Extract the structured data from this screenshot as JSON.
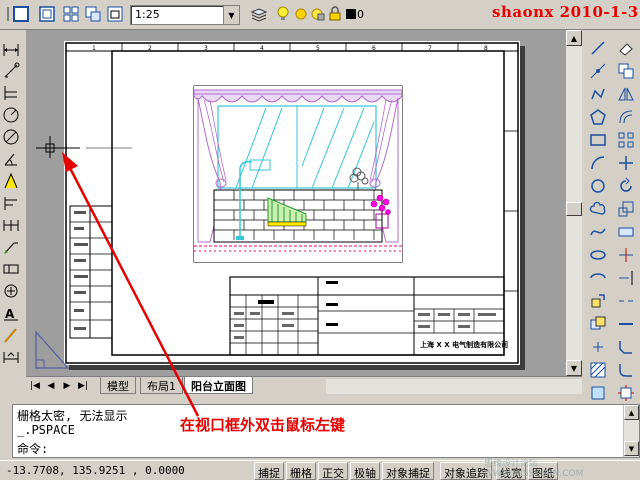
{
  "toolbar": {
    "scale": "1:25",
    "layer_value": "0",
    "icons": [
      "new-viewport-icon",
      "single-viewport-icon",
      "clip-viewport-icon",
      "zoom-window-icon",
      "layer-manager-icon",
      "lightbulb-icon",
      "sun-icon",
      "color-square-icon"
    ]
  },
  "watermark_top": "shaonx  2010-1-3",
  "drawing": {
    "sheet_top_labels": [
      "1",
      "2",
      "3",
      "4",
      "5",
      "6",
      "7",
      "8"
    ],
    "title_block_company": "上海 X X 电气制造有限公司"
  },
  "tabs": {
    "items": [
      "模型",
      "布局1",
      "阳台立面图"
    ],
    "active": "阳台立面图"
  },
  "command": {
    "line1": "栅格太密, 无法显示",
    "line2": "_.PSPACE",
    "prompt": "命令:"
  },
  "annotation": "在视口框外双击鼠标左键",
  "status": {
    "coords": "-13.7708,   135.9251 ,  0.0000",
    "buttons": [
      "捕捉",
      "栅格",
      "正交",
      "极轴",
      "对象捕捉",
      "对象追踪",
      "线宽",
      "图纸"
    ]
  },
  "watermark_bottom": "思缘设计论坛 WWW.MISSYUAN.COM",
  "colors": {
    "accent_red": "#e60000",
    "curtain_purple": "#b36bd1",
    "window_cyan": "#33c8d8"
  }
}
